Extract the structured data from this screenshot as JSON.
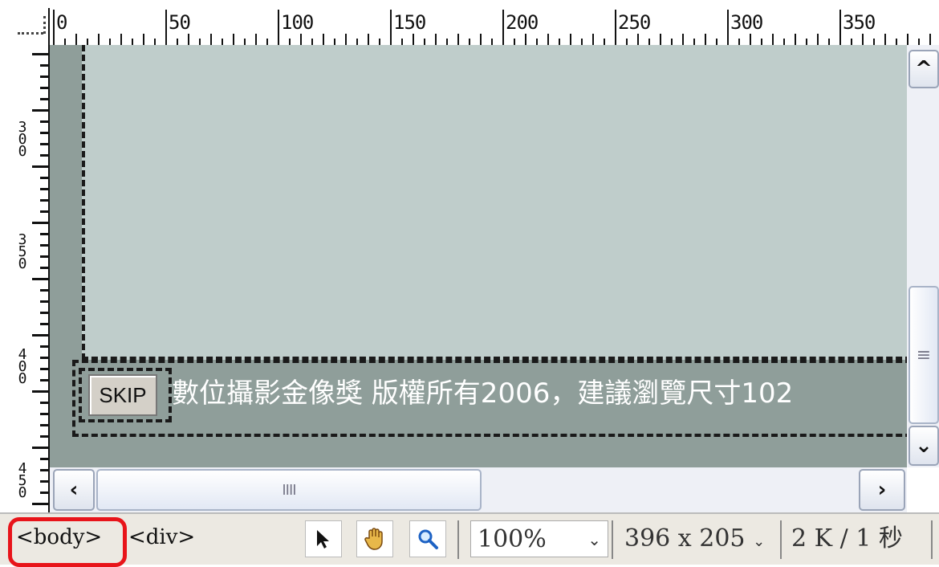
{
  "ruler": {
    "h_labels": [
      "0",
      "50",
      "100",
      "150",
      "200",
      "250",
      "300",
      "350"
    ],
    "v_labels": [
      "300",
      "350",
      "400",
      "450"
    ]
  },
  "canvas": {
    "skip_label": "SKIP",
    "footer_text": "數位攝影金像獎 版權所有2006，建議瀏覽尺寸102"
  },
  "status_bar": {
    "tag_body": "<body>",
    "tag_div": "<div>",
    "zoom": "100%",
    "dimensions": "396 x 205",
    "size_time": "2 K / 1 秒"
  },
  "colors": {
    "content_bg": "#bfcdcb",
    "canvas_bg": "#8f9e9a",
    "highlight_ring": "#e8141a"
  },
  "icons": {
    "tools": [
      "pointer-arrow-icon",
      "hand-icon",
      "zoom-magnifier-icon"
    ],
    "scroll": [
      "chevron-up-icon",
      "chevron-down-icon",
      "chevron-left-icon",
      "chevron-right-icon",
      "grip-icon"
    ]
  }
}
